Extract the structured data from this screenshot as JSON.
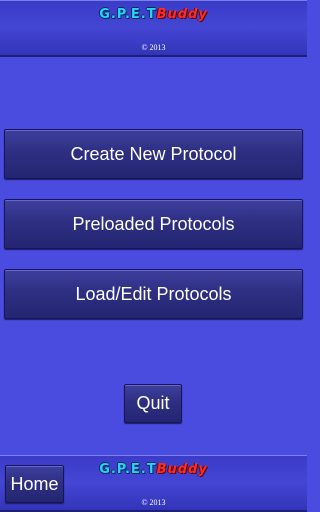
{
  "header": {
    "logo_main": "G.P.E.T",
    "logo_sub": "Buddy",
    "copyright": "© 2013"
  },
  "menu": {
    "create_label": "Create New Protocol",
    "preloaded_label": "Preloaded Protocols",
    "load_edit_label": "Load/Edit Protocols"
  },
  "quit_label": "Quit",
  "footer": {
    "home_label": "Home",
    "logo_main": "G.P.E.T",
    "logo_sub": "Buddy",
    "copyright": "© 2013"
  },
  "colors": {
    "background": "#4a4ce0",
    "button": "#2e2f82",
    "logo_main": "#2bd1f0",
    "logo_sub": "#ff2a2a"
  }
}
